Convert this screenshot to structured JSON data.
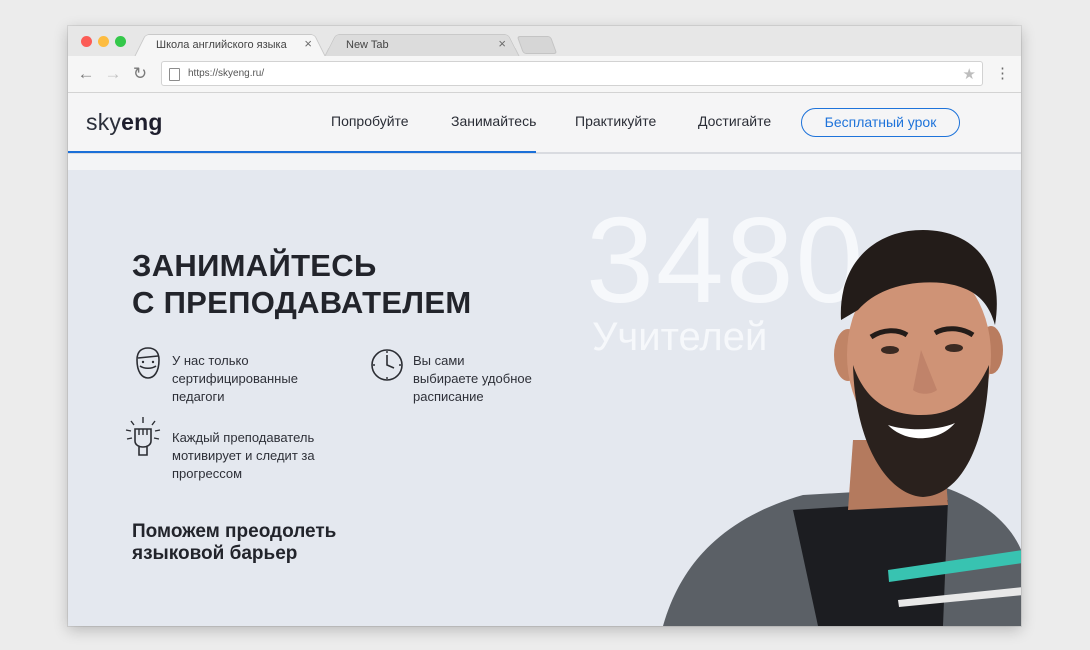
{
  "browser": {
    "tabs": [
      {
        "label": "Школа английского языка",
        "close": "×"
      },
      {
        "label": "New Tab",
        "close": "×"
      }
    ],
    "nav": {
      "back": "←",
      "forward": "→",
      "reload": "↻"
    },
    "url": "https://skyeng.ru/",
    "star": "★",
    "menu": "⋮"
  },
  "site": {
    "logo": {
      "part1": "sky",
      "part2": "eng"
    },
    "nav": [
      "Попробуйте",
      "Занимайтесь",
      "Практикуйте",
      "Достигайте"
    ],
    "cta": "Бесплатный урок"
  },
  "hero": {
    "headline": [
      "ЗАНИМАЙТЕСЬ",
      "С ПРЕПОДАВАТЕЛЕМ"
    ],
    "big_number": "3480",
    "big_word": "Учителей",
    "features": [
      {
        "lines": [
          "У нас только",
          "сертифицированные",
          "педагоги"
        ],
        "icon": "teacher-face-icon"
      },
      {
        "lines": [
          "Вы сами",
          "выбираете удобное",
          "расписание"
        ],
        "icon": "clock-icon"
      },
      {
        "lines": [
          "Каждый преподаватель",
          "мотивирует и следит за",
          "прогрессом"
        ],
        "icon": "fist-icon"
      }
    ],
    "subhead": [
      "Поможем преодолеть",
      "языковой барьер"
    ]
  },
  "colors": {
    "accent": "#1e73da",
    "hero_bg": "#e4e8ef"
  }
}
